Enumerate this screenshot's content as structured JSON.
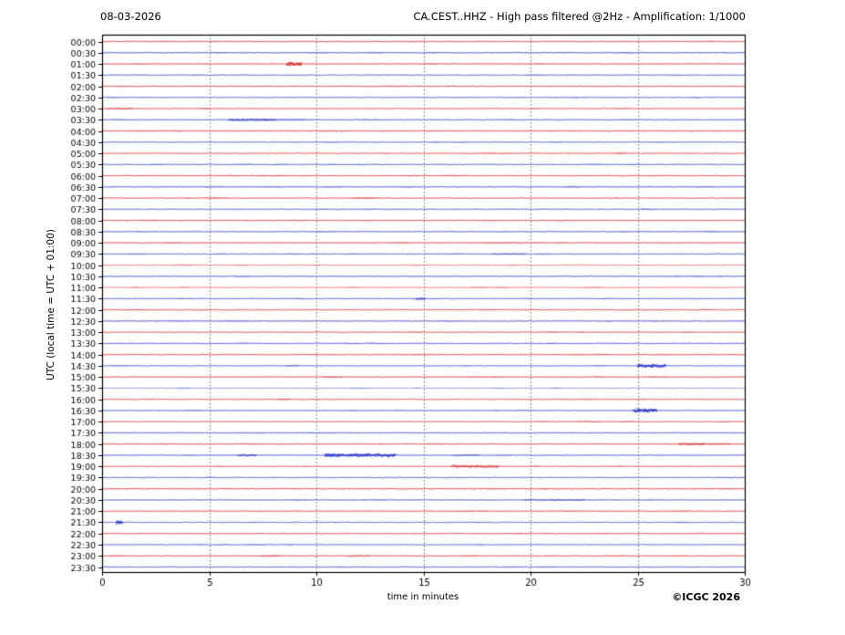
{
  "header": {
    "date": "08-03-2026",
    "station_title": "CA.CEST..HHZ - High pass filtered @2Hz - Amplification: 1/1000"
  },
  "footer": {
    "copyright": "©ICGC 2026"
  },
  "chart_data": {
    "type": "line",
    "subtype": "helicorder-seismogram",
    "title": "CA.CEST..HHZ - High pass filtered @2Hz - Amplification: 1/1000",
    "date": "08-03-2026",
    "xlabel": "time in minutes",
    "ylabel": "UTC (local time = UTC + 01:00)",
    "xlim": [
      0,
      30
    ],
    "x_ticks": [
      0,
      5,
      10,
      15,
      20,
      25,
      30
    ],
    "grid": "vertical dotted gridlines every 5 minutes",
    "legend_position": "none",
    "row_interval_minutes": 30,
    "row_labels": [
      "00:00",
      "00:30",
      "01:00",
      "01:30",
      "02:00",
      "02:30",
      "03:00",
      "03:30",
      "04:00",
      "04:30",
      "05:00",
      "05:30",
      "06:00",
      "06:30",
      "07:00",
      "07:30",
      "08:00",
      "08:30",
      "09:00",
      "09:30",
      "10:00",
      "10:30",
      "11:00",
      "11:30",
      "12:00",
      "12:30",
      "13:00",
      "13:30",
      "14:00",
      "14:30",
      "15:00",
      "15:30",
      "16:00",
      "16:30",
      "17:00",
      "17:30",
      "18:00",
      "18:30",
      "19:00",
      "19:30",
      "20:00",
      "20:30",
      "21:00",
      "21:30",
      "22:00",
      "22:30",
      "23:00",
      "23:30"
    ],
    "row_color_rule": "rows on the hour are red, rows on the half-hour are blue",
    "trace_colors": {
      "hour_rows": "#e75a5a",
      "half_hour_rows": "#646ed8"
    },
    "event_colors": {
      "hour_rows": "#d42a2a",
      "half_hour_rows": "#2a35cc"
    },
    "grid_color": "#555555",
    "frame_color": "#000000",
    "light_rows": [
      "10:00",
      "11:00",
      "15:30"
    ],
    "events": [
      {
        "row": "01:00",
        "start_min": 8.6,
        "end_min": 9.3,
        "intensity": "strong"
      },
      {
        "row": "03:00",
        "start_min": 0.2,
        "end_min": 1.4,
        "intensity": "mild"
      },
      {
        "row": "03:00",
        "start_min": 4.6,
        "end_min": 5.0,
        "intensity": "mild"
      },
      {
        "row": "03:30",
        "start_min": 5.9,
        "end_min": 8.1,
        "intensity": "moderate"
      },
      {
        "row": "03:30",
        "start_min": 8.1,
        "end_min": 9.4,
        "intensity": "mild"
      },
      {
        "row": "09:30",
        "start_min": 18.2,
        "end_min": 19.8,
        "intensity": "mild"
      },
      {
        "row": "11:30",
        "start_min": 14.6,
        "end_min": 15.1,
        "intensity": "moderate"
      },
      {
        "row": "14:30",
        "start_min": 8.6,
        "end_min": 9.2,
        "intensity": "mild"
      },
      {
        "row": "14:30",
        "start_min": 25.0,
        "end_min": 26.3,
        "intensity": "strong"
      },
      {
        "row": "15:00",
        "start_min": 10.3,
        "end_min": 11.2,
        "intensity": "mild"
      },
      {
        "row": "16:00",
        "start_min": 8.2,
        "end_min": 8.8,
        "intensity": "mild"
      },
      {
        "row": "16:30",
        "start_min": 24.8,
        "end_min": 25.9,
        "intensity": "strong"
      },
      {
        "row": "18:00",
        "start_min": 26.9,
        "end_min": 28.1,
        "intensity": "moderate"
      },
      {
        "row": "18:00",
        "start_min": 28.1,
        "end_min": 29.4,
        "intensity": "mild"
      },
      {
        "row": "18:30",
        "start_min": 6.3,
        "end_min": 7.2,
        "intensity": "moderate"
      },
      {
        "row": "18:30",
        "start_min": 10.4,
        "end_min": 13.7,
        "intensity": "strong"
      },
      {
        "row": "18:30",
        "start_min": 16.4,
        "end_min": 17.6,
        "intensity": "mild"
      },
      {
        "row": "19:00",
        "start_min": 16.3,
        "end_min": 18.5,
        "intensity": "moderate"
      },
      {
        "row": "20:30",
        "start_min": 19.7,
        "end_min": 22.5,
        "intensity": "mild"
      },
      {
        "row": "21:30",
        "start_min": 0.65,
        "end_min": 0.95,
        "intensity": "strong"
      },
      {
        "row": "23:00",
        "start_min": 7.4,
        "end_min": 8.2,
        "intensity": "mild"
      },
      {
        "row": "23:00",
        "start_min": 11.4,
        "end_min": 12.5,
        "intensity": "mild"
      }
    ]
  }
}
